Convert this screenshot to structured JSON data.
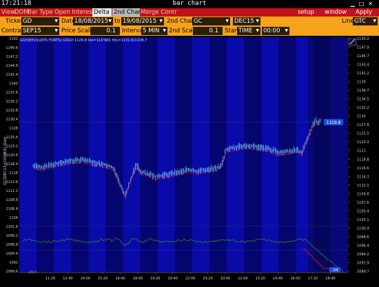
{
  "window": {
    "clock": "17:21:18",
    "title": "bar chart"
  },
  "menu": {
    "view": "View",
    "dom": "DOM",
    "bar_type": "Bar Type",
    "open_interest": "Open Interest",
    "tab_delta": "Delta",
    "tab_2nd_chart": "2nd Chart",
    "merge_contr": "Merge Contr",
    "setup": "setup",
    "window": "window",
    "apply": "Apply"
  },
  "controls": {
    "ticker_label": "Ticker",
    "ticker_value": "GD",
    "date_label": "Date",
    "date_from": "18/08/2015",
    "date_to_label": "to",
    "date_to": "19/08/2015",
    "second_chart_label": "2nd Chart",
    "second_chart_value": "GC",
    "second_contract": "DEC15",
    "line_label": "Line",
    "line_value": "GTC",
    "contract_label": "Contract",
    "contract_value": "SEP15",
    "price_scale_label": "Price Scale",
    "price_scale_value": "0.1",
    "interval_label": "Interval",
    "interval_value": "5 MIN",
    "second_scale_label": "2nd Scale",
    "second_scale_value": "0.1",
    "start_label": "Start",
    "start_type": "TIME",
    "start_value": "00:00"
  },
  "chart": {
    "header": "GD(SEP15)(RTS FORTS) GOLD 1129.8 Vol=116'981 H/L=1131.6/1108.7",
    "y_axis_title": "GC(DEC15)(COMEX) Gold",
    "price_tag_right": "1129.8",
    "osc_tag_right": "-34",
    "osc_left_label": "-20.0",
    "left_ticks": [
      "1152",
      "1149.6",
      "1147.2",
      "1144.8",
      "1142.4",
      "1140",
      "1137.6",
      "1135.2",
      "1132.8",
      "1130.4",
      "1128",
      "1125.6",
      "1123.2",
      "1120.8",
      "1118.4",
      "1116",
      "1113.6",
      "1111.2",
      "1108.8",
      "1106.4",
      "1104",
      "1101.6",
      "1099.2",
      "1096.8",
      "1094.4",
      "1092",
      "1089.6"
    ],
    "right_ticks": [
      "1150.2",
      "1147.9",
      "1145.7",
      "1143.4",
      "1141.2",
      "1139",
      "1136.7",
      "1134.5",
      "1132.2",
      "1130",
      "1127.8",
      "1125.5",
      "1123.3",
      "1121",
      "1118.8",
      "1116.6",
      "1114.3",
      "1112.1",
      "1109.8",
      "1107.6",
      "1105.4",
      "1103.1",
      "1100.9",
      "1098.6",
      "1096.4",
      "1094.2",
      "1091.9",
      "1089.7"
    ],
    "x_ticks": [
      "11:20",
      "12:40",
      "14:00",
      "15:20",
      "16:40",
      "18:00",
      "19:20",
      "20:40",
      "22:00",
      "23:20",
      "10:40",
      "12:00",
      "13:20",
      "14:40",
      "16:00",
      "17:20",
      "18:40"
    ],
    "colors": {
      "band_dark": "#050570",
      "band_light": "#0a0aa8",
      "price_line": "#6ec3f0",
      "second_line": "#d01818",
      "oscillator": "#2a8a2a",
      "price_tag_bg": "#1f4fd8"
    }
  }
}
